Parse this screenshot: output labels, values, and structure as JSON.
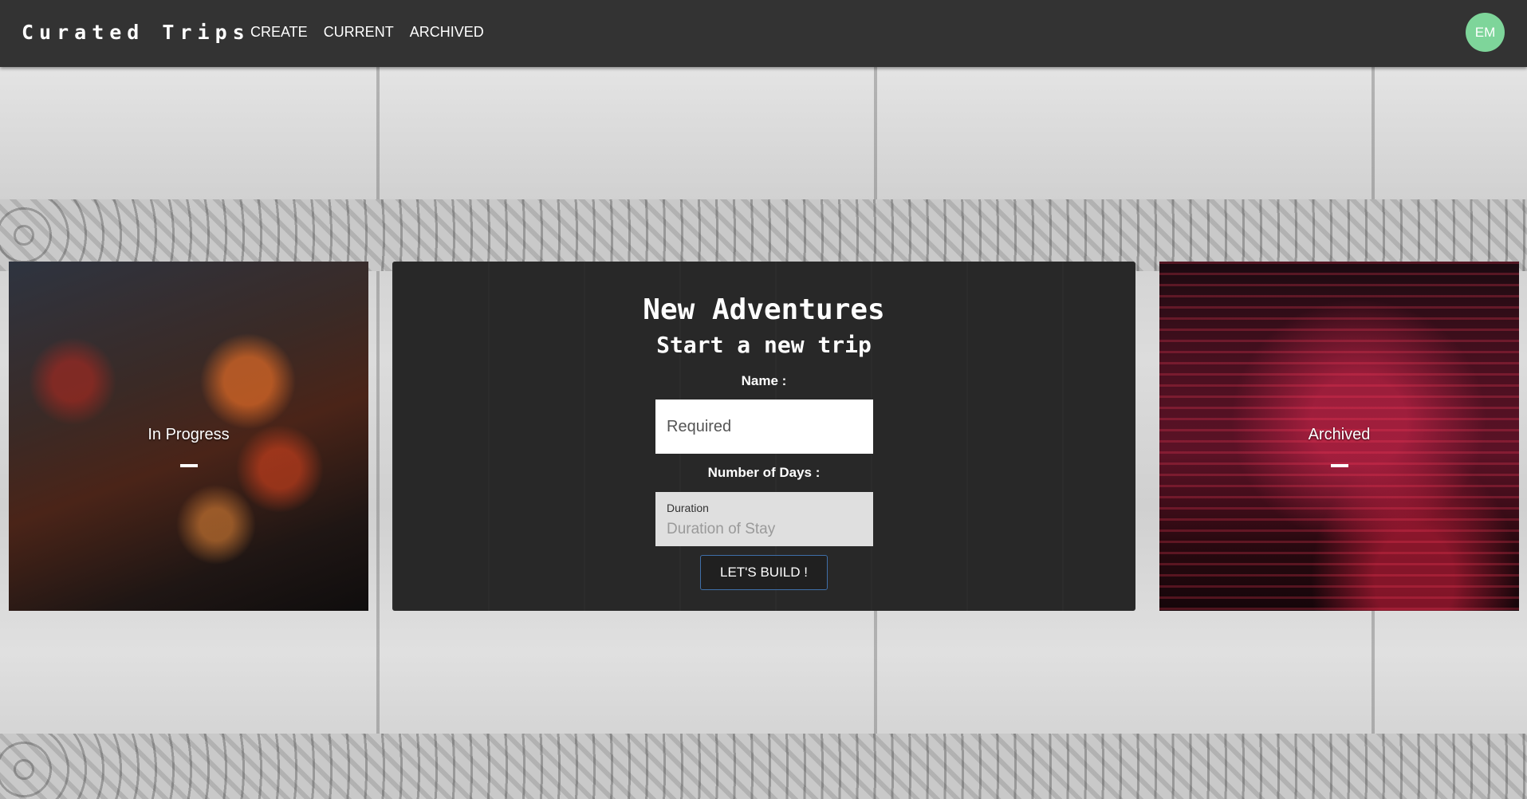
{
  "nav": {
    "brand": "Curated Trips",
    "links": [
      "CREATE",
      "CURRENT",
      "ARCHIVED"
    ],
    "avatar_initials": "EM",
    "avatar_color": "#7ed59a"
  },
  "cards": {
    "left": {
      "title": "In Progress"
    },
    "right": {
      "title": "Archived"
    }
  },
  "form": {
    "title": "New Adventures",
    "subtitle": "Start a new trip",
    "name_label": "Name :",
    "name_placeholder": "Required",
    "days_label": "Number of Days :",
    "days_field_label": "Duration",
    "days_placeholder": "Duration of Stay",
    "submit_label": "LET'S BUILD !"
  }
}
